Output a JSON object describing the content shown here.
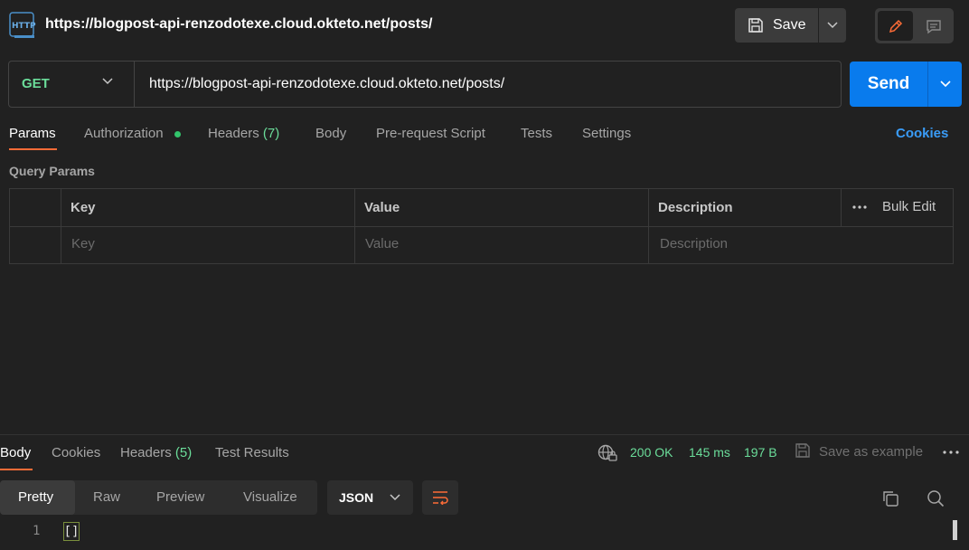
{
  "header": {
    "icon": "http-icon",
    "title": "https://blogpost-api-renzodotexe.cloud.okteto.net/posts/",
    "save_label": "Save"
  },
  "request": {
    "method": "GET",
    "url": "https://blogpost-api-renzodotexe.cloud.okteto.net/posts/",
    "send_label": "Send"
  },
  "request_tabs": {
    "params": "Params",
    "authorization": "Authorization",
    "headers": "Headers",
    "headers_count": "(7)",
    "body": "Body",
    "pre_request": "Pre-request Script",
    "tests": "Tests",
    "settings": "Settings",
    "cookies": "Cookies"
  },
  "query_params": {
    "title": "Query Params",
    "columns": [
      "Key",
      "Value",
      "Description"
    ],
    "bulk_edit": "Bulk Edit",
    "placeholders": {
      "key": "Key",
      "value": "Value",
      "description": "Description"
    }
  },
  "response_tabs": {
    "body": "Body",
    "cookies": "Cookies",
    "headers": "Headers",
    "headers_count": "(5)",
    "test_results": "Test Results"
  },
  "response_status": {
    "status": "200 OK",
    "time": "145 ms",
    "size": "197 B",
    "save_example": "Save as example"
  },
  "response_view": {
    "formats": [
      "Pretty",
      "Raw",
      "Preview",
      "Visualize"
    ],
    "language": "JSON"
  },
  "response_body": {
    "lines": [
      {
        "number": "1",
        "text": "[]"
      }
    ]
  },
  "colors": {
    "accent": "#ff6c37",
    "send": "#097bed",
    "success": "#6bdd9a",
    "link": "#3a9cf7"
  }
}
